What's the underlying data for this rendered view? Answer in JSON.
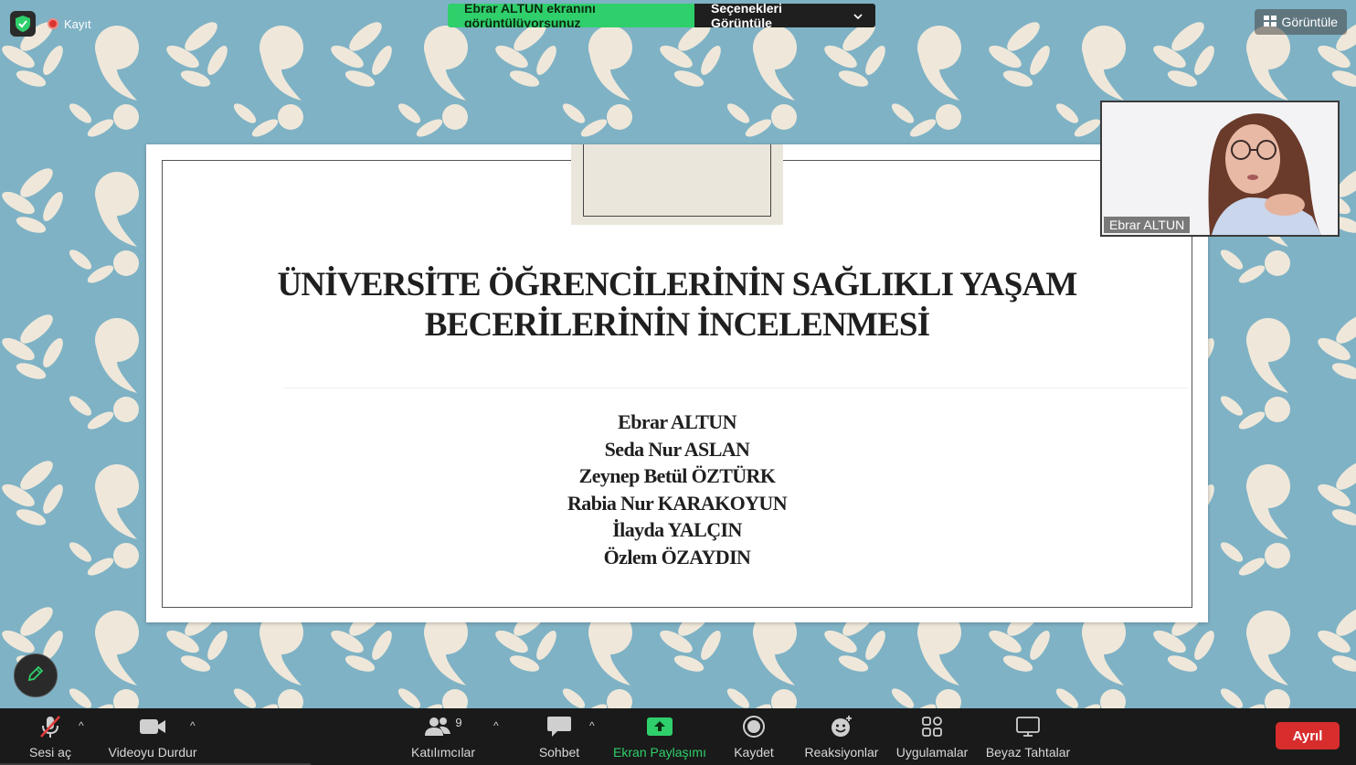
{
  "top": {
    "recording_label": "Kayıt",
    "share_banner_text": "Ebrar ALTUN ekranını görüntülüyorsunuz",
    "view_options_label": "Seçenekleri Görüntüle",
    "view_button_label": "Görüntüle"
  },
  "slide": {
    "title_line1": "ÜNİVERSİTE ÖĞRENCİLERİNİN SAĞLIKLI YAŞAM",
    "title_line2": "BECERİLERİNİN İNCELENMESİ",
    "authors": [
      "Ebrar ALTUN",
      "Seda Nur ASLAN",
      "Zeynep Betül ÖZTÜRK",
      "Rabia Nur KARAKOYUN",
      "İlayda YALÇIN",
      "Özlem ÖZAYDIN"
    ]
  },
  "video": {
    "participant_name": "Ebrar ALTUN"
  },
  "toolbar": {
    "unmute_label": "Sesi aç",
    "stop_video_label": "Videoyu Durdur",
    "participants_label": "Katılımcılar",
    "participants_count": "9",
    "chat_label": "Sohbet",
    "share_screen_label": "Ekran Paylaşımı",
    "record_label": "Kaydet",
    "reactions_label": "Reaksiyonlar",
    "apps_label": "Uygulamalar",
    "whiteboards_label": "Beyaz Tahtalar",
    "leave_label": "Ayrıl"
  },
  "colors": {
    "background_blue": "#7fb2c5",
    "leaf_cream": "#efe8da",
    "share_green": "#2fcf6b",
    "leave_red": "#d72d2d"
  }
}
